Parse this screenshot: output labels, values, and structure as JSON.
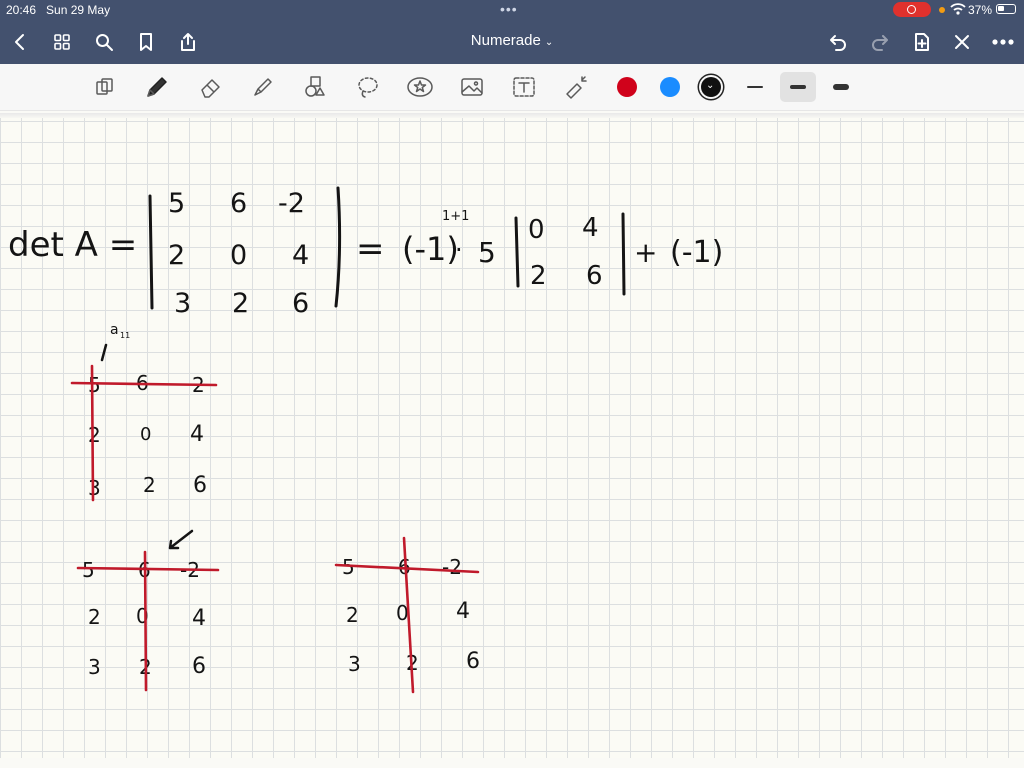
{
  "status_bar": {
    "time": "20:46",
    "date": "Sun 29 May",
    "battery": "37%"
  },
  "nav": {
    "title": "Numerade"
  },
  "toolbar": {
    "colors": {
      "red": "#d0021b",
      "blue": "#1a8cff",
      "black": "#111111"
    },
    "tools": [
      "pages-icon",
      "pen-icon",
      "eraser-icon",
      "highlighter-icon",
      "shapes-icon",
      "lasso-icon",
      "sticker-icon",
      "image-icon",
      "text-icon",
      "laser-icon"
    ]
  },
  "notes": {
    "main_eq": {
      "lhs": "det A =",
      "m": [
        [
          "5",
          "6",
          "-2"
        ],
        [
          "2",
          "0",
          "4"
        ],
        [
          "3",
          "2",
          "6"
        ]
      ],
      "rhs_eq": "=",
      "sign_term": "(-1)",
      "exponent": "1+1",
      "dot": "·",
      "coef": "5",
      "minor": [
        [
          "0",
          "4"
        ],
        [
          "2",
          "6"
        ]
      ],
      "plus": "+",
      "next_sign": "(-1)"
    },
    "a11_label": "a",
    "a11_sub": "11",
    "matrix1": [
      [
        "5",
        "6",
        "2"
      ],
      [
        "2",
        "0",
        "4"
      ],
      [
        "3",
        "2",
        "6"
      ]
    ],
    "matrix2": [
      [
        "5",
        "6",
        "-2"
      ],
      [
        "2",
        "0",
        "4"
      ],
      [
        "3",
        "2",
        "6"
      ]
    ],
    "matrix3": [
      [
        "5",
        "6",
        "-2"
      ],
      [
        "2",
        "0",
        "4"
      ],
      [
        "3",
        "2",
        "6"
      ]
    ]
  }
}
